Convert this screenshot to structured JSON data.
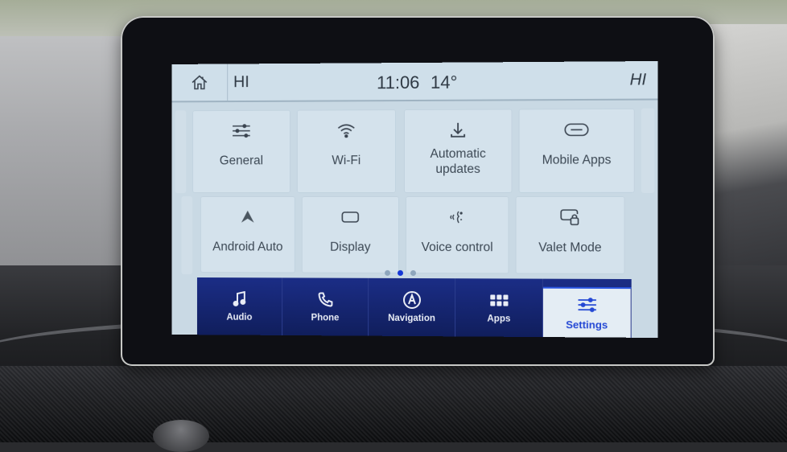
{
  "status_bar": {
    "home_icon": "home-icon",
    "left_label": "HI",
    "time": "11:06",
    "temperature": "14°",
    "right_label": "HI"
  },
  "settings_tiles": [
    {
      "label": "General",
      "icon": "sliders-icon"
    },
    {
      "label": "Wi-Fi",
      "icon": "wifi-icon"
    },
    {
      "label": "Automatic updates",
      "icon": "download-icon"
    },
    {
      "label": "Mobile Apps",
      "icon": "link-icon"
    },
    {
      "label": "Android Auto",
      "icon": "android-auto-icon"
    },
    {
      "label": "Display",
      "icon": "display-icon"
    },
    {
      "label": "Voice control",
      "icon": "voice-icon"
    },
    {
      "label": "Valet Mode",
      "icon": "valet-lock-icon"
    }
  ],
  "pagination": {
    "pages": 3,
    "current": 2
  },
  "nav_bar": {
    "items": [
      {
        "label": "Audio",
        "icon": "music-note-icon",
        "active": false
      },
      {
        "label": "Phone",
        "icon": "phone-icon",
        "active": false
      },
      {
        "label": "Navigation",
        "icon": "navigation-icon",
        "active": false
      },
      {
        "label": "Apps",
        "icon": "apps-grid-icon",
        "active": false
      },
      {
        "label": "Settings",
        "icon": "sliders-icon",
        "active": true
      }
    ],
    "active_color": "#2448d4",
    "bar_color": "#1b2d86"
  }
}
